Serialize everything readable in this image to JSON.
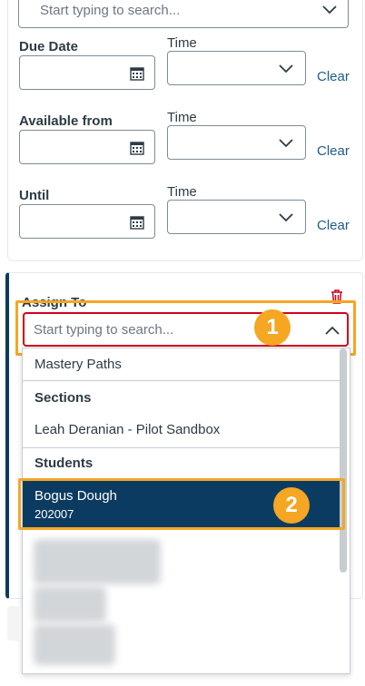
{
  "top_search": {
    "placeholder": "Start typing to search..."
  },
  "dates": [
    {
      "label": "Due Date",
      "time_label": "Time",
      "clear": "Clear"
    },
    {
      "label": "Available from",
      "time_label": "Time",
      "clear": "Clear"
    },
    {
      "label": "Until",
      "time_label": "Time",
      "clear": "Clear"
    }
  ],
  "assign": {
    "label": "Assign To",
    "search_placeholder": "Start typing to search...",
    "options": {
      "mastery_paths": "Mastery Paths",
      "sections_header": "Sections",
      "section_1": "Leah Deranian - Pilot Sandbox",
      "students_header": "Students",
      "selected_student_name": "Bogus Dough",
      "selected_student_id": "202007"
    }
  },
  "callouts": {
    "one": "1",
    "two": "2"
  },
  "colors": {
    "accent": "#0c3b61",
    "callout": "#f5a623",
    "link": "#1f5c8a",
    "danger": "#d0021b"
  },
  "icons": [
    "calendar-icon",
    "chevron-down-icon",
    "chevron-up-icon",
    "trash-icon"
  ]
}
